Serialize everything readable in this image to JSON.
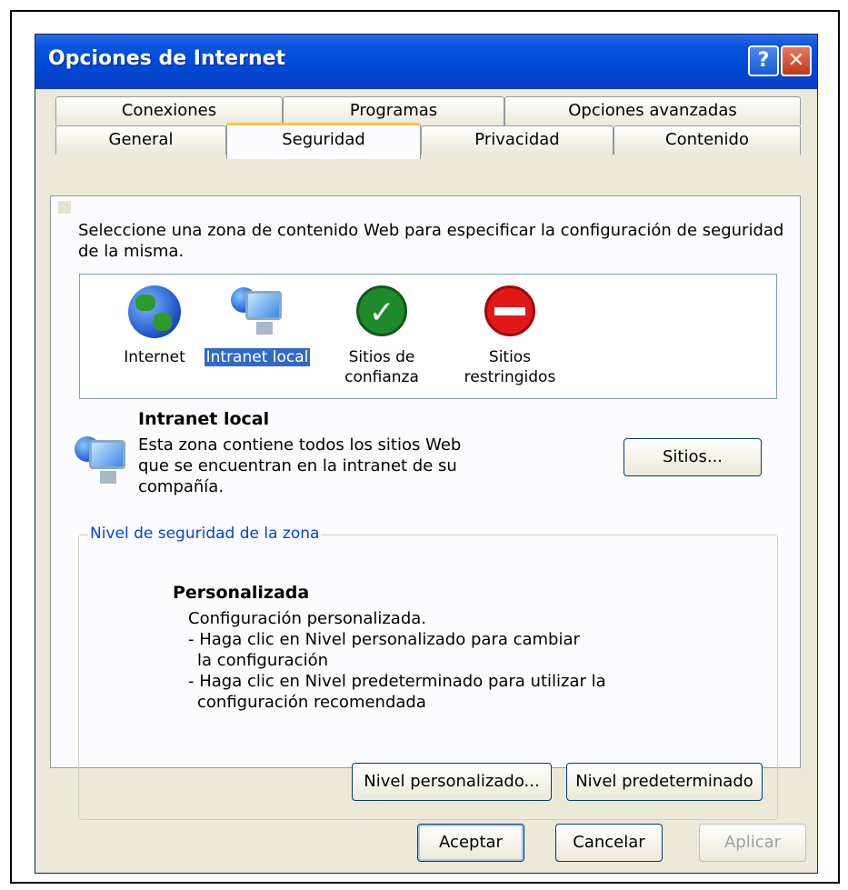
{
  "window": {
    "title": "Opciones de Internet",
    "help_glyph": "?",
    "close_glyph": "✕"
  },
  "tabs": {
    "back_row": [
      "Conexiones",
      "Programas",
      "Opciones avanzadas"
    ],
    "front_row": [
      "General",
      "Seguridad",
      "Privacidad",
      "Contenido"
    ],
    "active": "Seguridad"
  },
  "security": {
    "intro": "Seleccione una zona de contenido Web para especificar la configuración de seguridad de la misma.",
    "zones": [
      {
        "label": "Internet",
        "icon": "globe-icon"
      },
      {
        "label": "Intranet local",
        "icon": "intranet-monitor-icon",
        "selected": true
      },
      {
        "label": "Sitios de confianza",
        "icon": "check-icon"
      },
      {
        "label": "Sitios restringidos",
        "icon": "no-entry-icon"
      }
    ],
    "selected_zone_title": "Intranet local",
    "selected_zone_desc": "Esta zona contiene todos los sitios Web que se encuentran en la intranet de su compañía.",
    "sites_button": "Sitios...",
    "level_group_label": "Nivel de seguridad de la zona",
    "level_title": "Personalizada",
    "level_lines": [
      "Configuración personalizada.",
      "- Haga clic en Nivel personalizado para cambiar",
      "  la configuración",
      "- Haga clic en Nivel predeterminado para utilizar la",
      "  configuración recomendada"
    ],
    "custom_level_button": "Nivel personalizado...",
    "default_level_button": "Nivel predeterminado"
  },
  "footer": {
    "ok": "Aceptar",
    "cancel": "Cancelar",
    "apply": "Aplicar"
  },
  "colors": {
    "titlebar": "#0a56e0",
    "selection": "#316ac5",
    "group_label": "#0046d5"
  }
}
